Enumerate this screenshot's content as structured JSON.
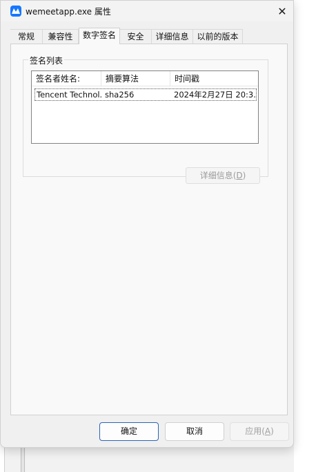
{
  "window": {
    "title": "wemeetapp.exe 属性",
    "close_glyph": "✕",
    "accent_color": "#1677ff"
  },
  "tabs": [
    {
      "label": "常规"
    },
    {
      "label": "兼容性"
    },
    {
      "label": "数字签名",
      "active": true
    },
    {
      "label": "安全"
    },
    {
      "label": "详细信息"
    },
    {
      "label": "以前的版本"
    }
  ],
  "signature_group": {
    "label": "签名列表",
    "columns": [
      "签名者姓名:",
      "摘要算法",
      "时间戳"
    ],
    "rows": [
      {
        "signer": "Tencent Technol...",
        "digest": "sha256",
        "timestamp": "2024年2月27日 20:3..."
      }
    ],
    "details_button": {
      "label": "详细信息(",
      "mnemonic": "D",
      "suffix": ")",
      "enabled": false
    }
  },
  "footer": {
    "ok": "确定",
    "cancel": "取消",
    "apply": {
      "label": "应用(",
      "mnemonic": "A",
      "suffix": ")",
      "enabled": false
    }
  }
}
